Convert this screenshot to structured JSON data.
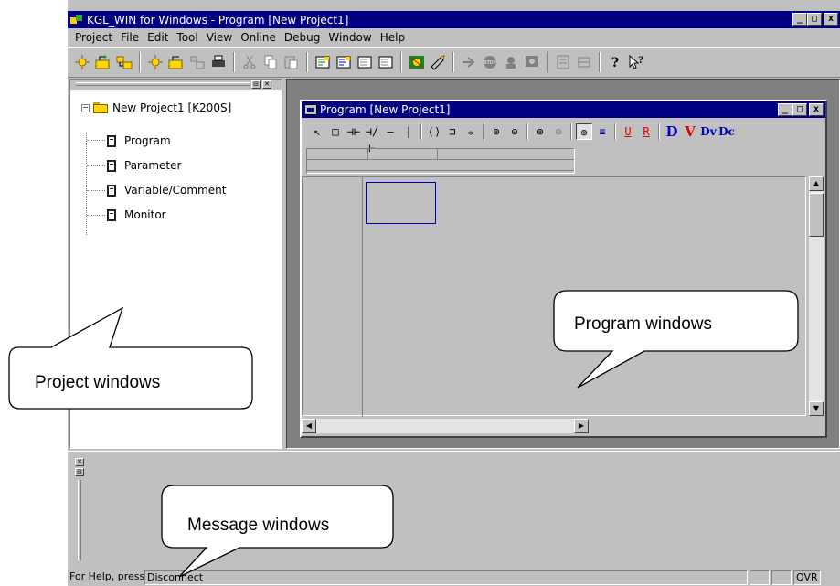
{
  "window": {
    "title": "KGL_WIN for Windows - Program [New Project1]",
    "minimize_label": "_",
    "maximize_label": "□",
    "close_label": "x"
  },
  "menu": [
    "Project",
    "File",
    "Edit",
    "Tool",
    "View",
    "Online",
    "Debug",
    "Window",
    "Help"
  ],
  "toolbar_icons": [
    "new-project-icon",
    "open-project-icon",
    "save-project-icon",
    "new-file-icon",
    "open-file-icon",
    "save-file-icon",
    "print-icon",
    "cut-icon",
    "copy-icon",
    "paste-icon",
    "compile-icon",
    "compile-all-icon",
    "make-icon",
    "build-icon",
    "connect-icon",
    "download-icon",
    "run-icon",
    "stop-icon",
    "pause-icon",
    "monitor-icon",
    "io-icon",
    "ladder-view-icon",
    "help-icon",
    "context-help-icon"
  ],
  "project_tree": {
    "root_expander": "−",
    "root_label": "New Project1 [K200S]",
    "children": [
      "Program",
      "Parameter",
      "Variable/Comment",
      "Monitor"
    ]
  },
  "program_window": {
    "title": "Program [New Project1]",
    "tools": [
      "↖",
      "□",
      "⊣⊢",
      "⊣/⊢",
      "—",
      "|",
      "⟨⟩",
      "⊐",
      "⁎",
      "⊕",
      "⊖",
      "⊕",
      "⊖",
      "⊕",
      "≡",
      "U",
      "R",
      "D",
      "V",
      "Dv",
      "Dc"
    ]
  },
  "status_bar": {
    "help_text": "For Help, press I",
    "connection": "Disconnect",
    "ovr": "OVR"
  },
  "annotations": {
    "project_windows": "Project windows",
    "program_windows": "Program windows",
    "message_windows": "Message windows"
  }
}
